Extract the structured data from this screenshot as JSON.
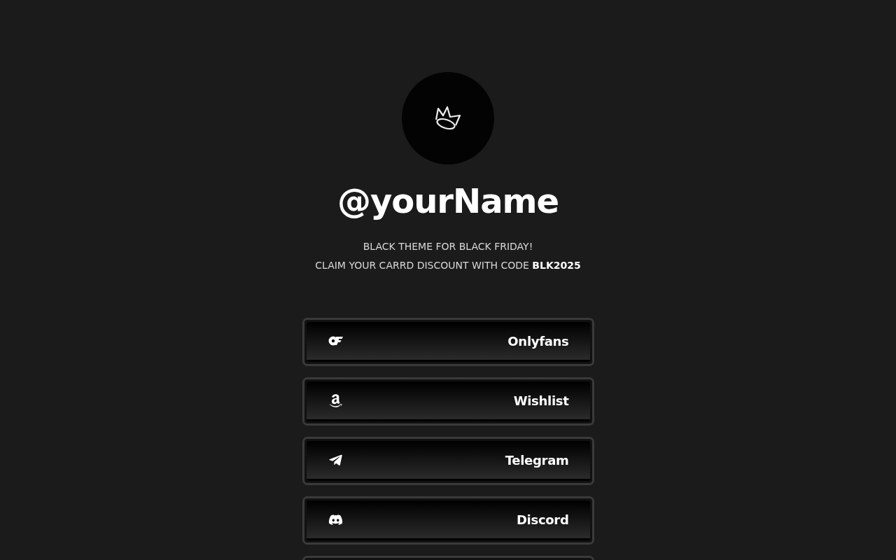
{
  "profile": {
    "handle": "@yourName",
    "bio": [
      "BLACK THEME FOR BLACK FRIDAY!",
      "CLAIM YOUR CARRD DISCOUNT WITH CODE **BLK2025**"
    ]
  },
  "links": [
    {
      "kind": "onlyfans",
      "label": "Onlyfans"
    },
    {
      "kind": "amazon",
      "label": "Wishlist"
    },
    {
      "kind": "telegram",
      "label": "Telegram"
    },
    {
      "kind": "discord",
      "label": "Discord"
    },
    {
      "kind": "cut"
    }
  ]
}
